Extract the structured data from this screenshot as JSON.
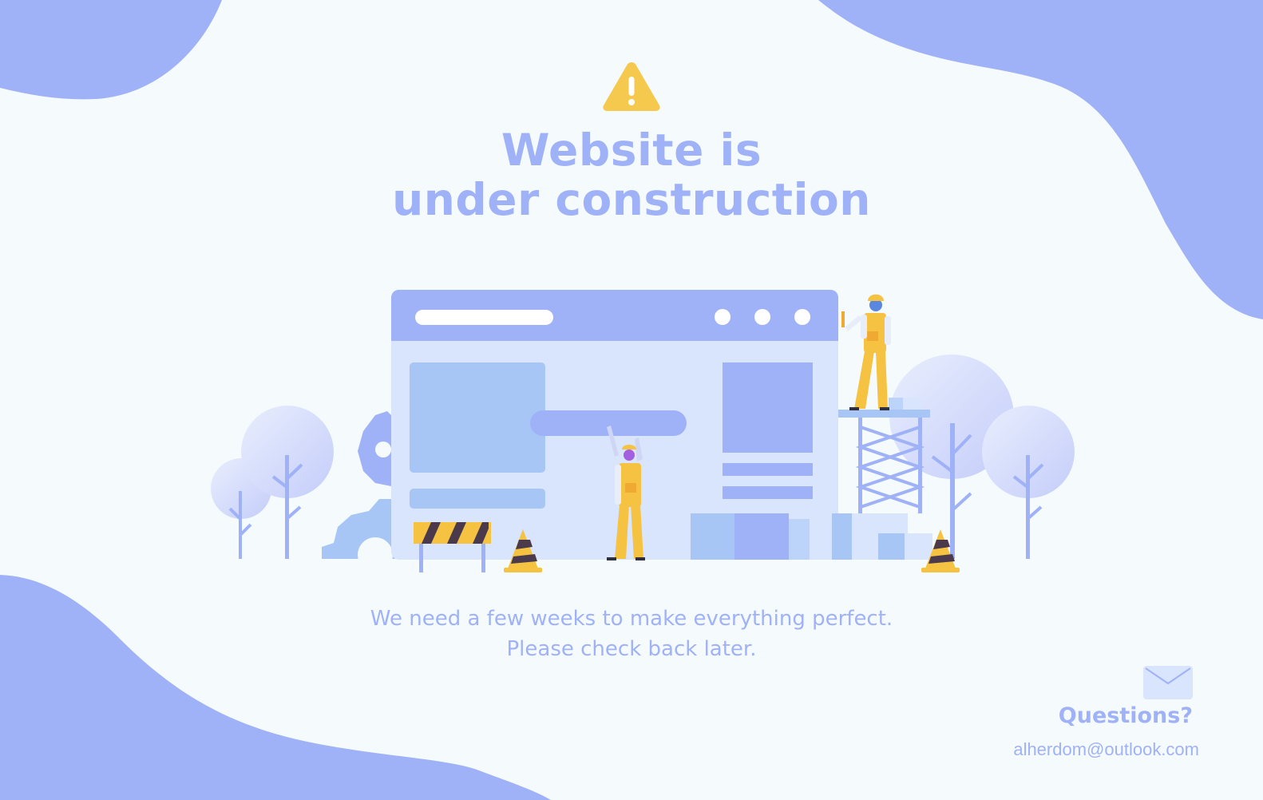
{
  "header": {
    "icon": "warning-icon",
    "title_line1": "Website is",
    "title_line2": "under construction"
  },
  "illustration": {
    "icons": [
      "browser-window-icon",
      "gear-icon",
      "tree-icon",
      "construction-worker-icon",
      "traffic-cone-icon",
      "barrier-icon",
      "scaffold-icon"
    ]
  },
  "message": {
    "line1": "We need a few weeks to make everything perfect.",
    "line2": "Please check back later."
  },
  "contact": {
    "icon": "mail-icon",
    "heading": "Questions?",
    "email": "alherdom@outlook.com"
  },
  "colors": {
    "primary": "#a0b2f7",
    "background": "#f5fbfd",
    "accent": "#f5c242",
    "window_body": "#d8e5fc",
    "window_panel": "#a7c6f5"
  }
}
